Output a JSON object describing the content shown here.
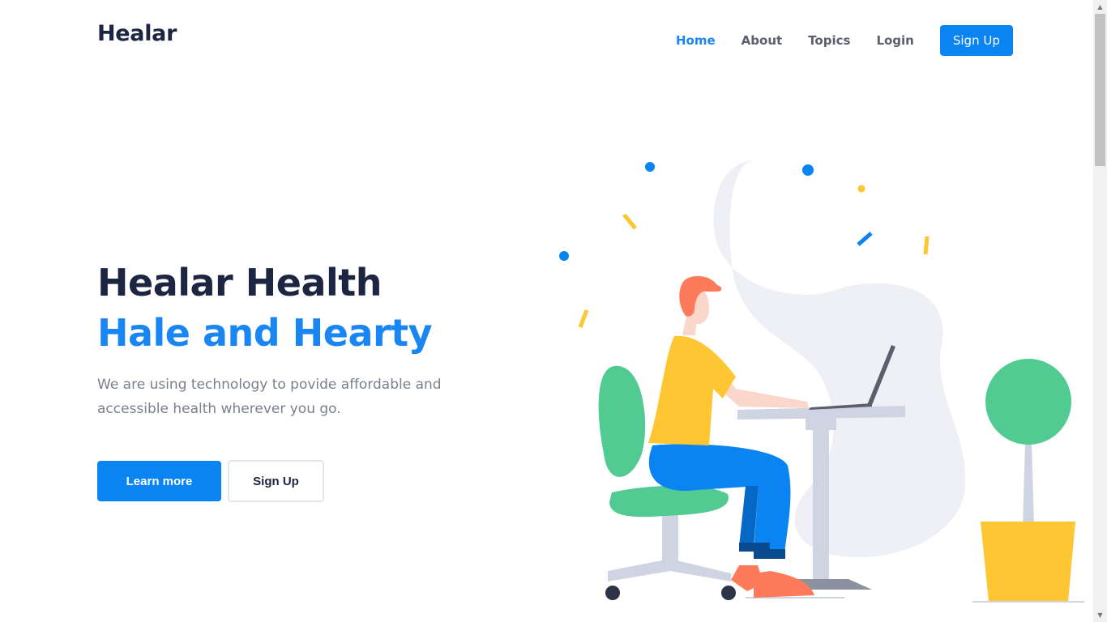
{
  "brand": {
    "name": "Healar"
  },
  "nav": {
    "items": [
      {
        "label": "Home",
        "active": true
      },
      {
        "label": "About",
        "active": false
      },
      {
        "label": "Topics",
        "active": false
      },
      {
        "label": "Login",
        "active": false
      }
    ],
    "signup_label": "Sign Up"
  },
  "hero": {
    "title": "Healar Health",
    "subtitle": "Hale and Hearty",
    "description": "We are using technology to povide affordable and accessible health wherever you go.",
    "learn_more_label": "Learn more",
    "signup_label": "Sign Up"
  },
  "colors": {
    "primary": "#0a84f2",
    "heading": "#1c2541",
    "body_text": "#7a7f8c",
    "accent_yellow": "#fdc632",
    "accent_green": "#52cb92"
  },
  "icons": {
    "scroll_up": "arrow-up-icon",
    "scroll_down": "arrow-down-icon"
  }
}
